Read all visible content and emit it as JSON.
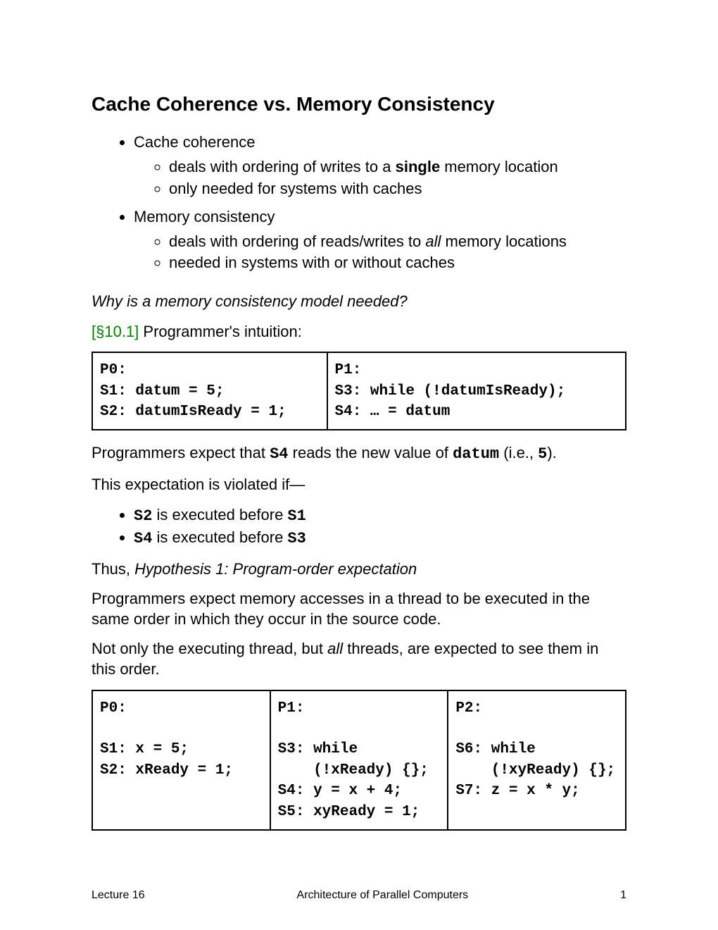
{
  "title": "Cache Coherence vs. Memory Consistency",
  "bullets": {
    "cc": {
      "label": "Cache coherence",
      "sub1a": "deals with ordering of writes to a ",
      "sub1b": "single",
      "sub1c": " memory location",
      "sub2": "only needed for systems with caches"
    },
    "mc": {
      "label": "Memory consistency",
      "sub1a": "deals with ordering of reads/writes to ",
      "sub1b": "all",
      "sub1c": " memory locations",
      "sub2": "needed in systems with or without caches"
    }
  },
  "question": "Why is a memory consistency model needed?",
  "ref": "[§10.1]",
  "intuition": "  Programmer's intuition:",
  "table1": {
    "left": "P0:\nS1: datum = 5;\nS2: datumIsReady = 1;",
    "right": "P1:\nS3: while (!datumIsReady);\nS4: … = datum"
  },
  "p1a": "Programmers expect that ",
  "p1b": "S4",
  "p1c": " reads the new value of ",
  "p1d": "datum",
  "p1e": " (i.e., ",
  "p1f": "5",
  "p1g": ").",
  "p2": "This expectation is violated if—",
  "violations": {
    "v1a": "S2",
    "v1b": " is executed before ",
    "v1c": "S1",
    "v2a": "S4",
    "v2b": " is executed before ",
    "v2c": "S3"
  },
  "hyp_lead": "Thus, ",
  "hyp": "Hypothesis 1: Program-order expectation",
  "p3": "Programmers expect memory accesses in a thread to be executed in the same order in which they occur in the source code.",
  "p4a": "Not only the executing thread, but ",
  "p4b": "all",
  "p4c": " threads, are expected to see them in this order.",
  "table2": {
    "c0": "P0:\n\nS1: x = 5;\nS2: xReady = 1;\n\n\n",
    "c1": "P1:\n\nS3: while\n    (!xReady) {};\nS4: y = x + 4;\nS5: xyReady = 1;\n",
    "c2": "P2:\n\nS6: while\n    (!xyReady) {};\nS7: z = x * y;\n\n"
  },
  "footer": {
    "left": "Lecture 16",
    "center": "Architecture of Parallel Computers",
    "right": "1"
  }
}
